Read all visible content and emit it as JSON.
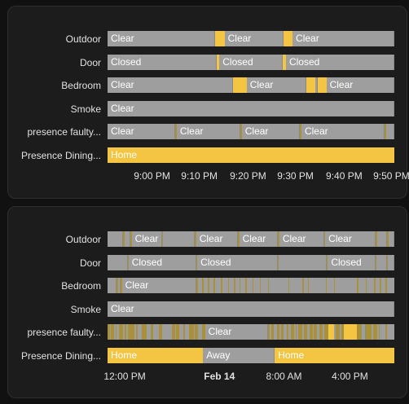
{
  "colors": {
    "gray": "#9e9e9e",
    "yellow": "#f4c542",
    "olive": "#a8913a",
    "background": "#111111",
    "card": "#1c1c1c"
  },
  "card1": {
    "rows": [
      {
        "label": "Outdoor",
        "segments": [
          {
            "start": 0,
            "end": 0.375,
            "state": "gray",
            "text": "Clear"
          },
          {
            "start": 0.375,
            "end": 0.408,
            "state": "yellow"
          },
          {
            "start": 0.408,
            "end": 0.615,
            "state": "gray",
            "text": "Clear"
          },
          {
            "start": 0.615,
            "end": 0.645,
            "state": "yellow"
          },
          {
            "start": 0.645,
            "end": 1,
            "state": "gray",
            "text": "Clear"
          }
        ]
      },
      {
        "label": "Door",
        "segments": [
          {
            "start": 0,
            "end": 0.38,
            "state": "gray",
            "text": "Closed"
          },
          {
            "start": 0.38,
            "end": 0.39,
            "state": "yellow"
          },
          {
            "start": 0.39,
            "end": 0.612,
            "state": "gray",
            "text": "Closed"
          },
          {
            "start": 0.612,
            "end": 0.622,
            "state": "yellow"
          },
          {
            "start": 0.622,
            "end": 1,
            "state": "gray",
            "text": "Closed"
          }
        ]
      },
      {
        "label": "Bedroom",
        "segments": [
          {
            "start": 0,
            "end": 0.437,
            "state": "gray",
            "text": "Clear"
          },
          {
            "start": 0.437,
            "end": 0.485,
            "state": "yellow"
          },
          {
            "start": 0.485,
            "end": 0.693,
            "state": "gray",
            "text": "Clear"
          },
          {
            "start": 0.693,
            "end": 0.725,
            "state": "yellow"
          },
          {
            "start": 0.725,
            "end": 0.733,
            "state": "gray"
          },
          {
            "start": 0.733,
            "end": 0.763,
            "state": "yellow"
          },
          {
            "start": 0.763,
            "end": 1,
            "state": "gray",
            "text": "Clear"
          }
        ]
      },
      {
        "label": "Smoke",
        "segments": [
          {
            "start": 0,
            "end": 1,
            "state": "gray",
            "text": "Clear"
          }
        ]
      },
      {
        "label": "presence faulty...",
        "segments": [
          {
            "start": 0,
            "end": 0.235,
            "state": "gray",
            "text": "Clear"
          },
          {
            "start": 0.235,
            "end": 0.241,
            "state": "olive"
          },
          {
            "start": 0.241,
            "end": 0.462,
            "state": "gray",
            "text": "Clear"
          },
          {
            "start": 0.462,
            "end": 0.468,
            "state": "olive"
          },
          {
            "start": 0.468,
            "end": 0.67,
            "state": "gray",
            "text": "Clear"
          },
          {
            "start": 0.67,
            "end": 0.676,
            "state": "olive"
          },
          {
            "start": 0.676,
            "end": 0.965,
            "state": "gray",
            "text": "Clear"
          },
          {
            "start": 0.965,
            "end": 0.971,
            "state": "olive"
          },
          {
            "start": 0.971,
            "end": 1,
            "state": "gray"
          }
        ]
      },
      {
        "label": "Presence Dining...",
        "segments": [
          {
            "start": 0,
            "end": 1,
            "state": "yellow",
            "text": "Home"
          }
        ]
      }
    ],
    "axis": [
      {
        "label": "9:00 PM",
        "pos": 0.155
      },
      {
        "label": "9:10 PM",
        "pos": 0.32
      },
      {
        "label": "9:20 PM",
        "pos": 0.49
      },
      {
        "label": "9:30 PM",
        "pos": 0.655
      },
      {
        "label": "9:40 PM",
        "pos": 0.825
      },
      {
        "label": "9:50 PM",
        "pos": 0.99
      }
    ]
  },
  "card2": {
    "rows": [
      {
        "label": "Outdoor",
        "segments": [
          {
            "start": 0,
            "end": 0.055,
            "state": "gray"
          },
          {
            "start": 0.055,
            "end": 0.059,
            "state": "olive"
          },
          {
            "start": 0.059,
            "end": 0.08,
            "state": "gray"
          },
          {
            "start": 0.08,
            "end": 0.084,
            "state": "olive"
          },
          {
            "start": 0.084,
            "end": 0.19,
            "state": "gray",
            "text": "Clear"
          },
          {
            "start": 0.19,
            "end": 0.194,
            "state": "olive"
          },
          {
            "start": 0.194,
            "end": 0.305,
            "state": "gray"
          },
          {
            "start": 0.305,
            "end": 0.309,
            "state": "olive"
          },
          {
            "start": 0.309,
            "end": 0.455,
            "state": "gray",
            "text": "Clear"
          },
          {
            "start": 0.455,
            "end": 0.459,
            "state": "olive"
          },
          {
            "start": 0.459,
            "end": 0.595,
            "state": "gray",
            "text": "Clear"
          },
          {
            "start": 0.595,
            "end": 0.599,
            "state": "olive"
          },
          {
            "start": 0.599,
            "end": 0.755,
            "state": "gray",
            "text": "Clear"
          },
          {
            "start": 0.755,
            "end": 0.759,
            "state": "olive"
          },
          {
            "start": 0.759,
            "end": 0.935,
            "state": "gray",
            "text": "Clear"
          },
          {
            "start": 0.935,
            "end": 0.939,
            "state": "olive"
          },
          {
            "start": 0.939,
            "end": 0.975,
            "state": "gray"
          },
          {
            "start": 0.975,
            "end": 0.979,
            "state": "olive"
          },
          {
            "start": 0.979,
            "end": 1,
            "state": "gray"
          }
        ]
      },
      {
        "label": "Door",
        "segments": [
          {
            "start": 0,
            "end": 0.07,
            "state": "gray"
          },
          {
            "start": 0.07,
            "end": 0.073,
            "state": "olive"
          },
          {
            "start": 0.073,
            "end": 0.31,
            "state": "gray",
            "text": "Closed"
          },
          {
            "start": 0.31,
            "end": 0.313,
            "state": "olive"
          },
          {
            "start": 0.313,
            "end": 0.595,
            "state": "gray",
            "text": "Closed"
          },
          {
            "start": 0.595,
            "end": 0.598,
            "state": "olive"
          },
          {
            "start": 0.598,
            "end": 0.765,
            "state": "gray"
          },
          {
            "start": 0.765,
            "end": 0.768,
            "state": "olive"
          },
          {
            "start": 0.768,
            "end": 0.935,
            "state": "gray",
            "text": "Closed"
          },
          {
            "start": 0.935,
            "end": 0.938,
            "state": "olive"
          },
          {
            "start": 0.938,
            "end": 0.975,
            "state": "gray"
          },
          {
            "start": 0.975,
            "end": 0.978,
            "state": "olive"
          },
          {
            "start": 0.978,
            "end": 1,
            "state": "gray"
          }
        ]
      },
      {
        "label": "Bedroom",
        "segments": [
          {
            "start": 0,
            "end": 0.032,
            "state": "gray"
          },
          {
            "start": 0.032,
            "end": 0.036,
            "state": "olive"
          },
          {
            "start": 0.036,
            "end": 0.045,
            "state": "gray"
          },
          {
            "start": 0.045,
            "end": 0.05,
            "state": "olive"
          },
          {
            "start": 0.05,
            "end": 0.31,
            "state": "gray",
            "text": "Clear"
          },
          {
            "start": 0.31,
            "end": 0.315,
            "state": "olive"
          },
          {
            "start": 0.33,
            "end": 0.335,
            "state": "olive"
          },
          {
            "start": 0.35,
            "end": 0.354,
            "state": "olive"
          },
          {
            "start": 0.37,
            "end": 0.375,
            "state": "olive"
          },
          {
            "start": 0.395,
            "end": 0.4,
            "state": "olive"
          },
          {
            "start": 0.42,
            "end": 0.424,
            "state": "olive"
          },
          {
            "start": 0.44,
            "end": 0.445,
            "state": "olive"
          },
          {
            "start": 0.46,
            "end": 0.463,
            "state": "olive"
          },
          {
            "start": 0.48,
            "end": 0.485,
            "state": "olive"
          },
          {
            "start": 0.505,
            "end": 0.508,
            "state": "olive"
          },
          {
            "start": 0.53,
            "end": 0.535,
            "state": "olive"
          },
          {
            "start": 0.56,
            "end": 0.563,
            "state": "olive"
          },
          {
            "start": 0.63,
            "end": 0.634,
            "state": "olive"
          },
          {
            "start": 0.68,
            "end": 0.684,
            "state": "olive"
          },
          {
            "start": 0.7,
            "end": 0.703,
            "state": "olive"
          },
          {
            "start": 0.76,
            "end": 0.764,
            "state": "olive"
          },
          {
            "start": 0.79,
            "end": 0.793,
            "state": "olive"
          },
          {
            "start": 0.87,
            "end": 0.874,
            "state": "olive"
          },
          {
            "start": 0.9,
            "end": 0.904,
            "state": "olive"
          },
          {
            "start": 0.93,
            "end": 0.934,
            "state": "olive"
          },
          {
            "start": 0.95,
            "end": 0.954,
            "state": "olive"
          },
          {
            "start": 0.97,
            "end": 0.974,
            "state": "olive"
          }
        ]
      },
      {
        "label": "Smoke",
        "segments": [
          {
            "start": 0,
            "end": 1,
            "state": "gray",
            "text": "Clear"
          }
        ]
      },
      {
        "label": "presence faulty...",
        "segments": [
          {
            "start": 0,
            "end": 0.008,
            "state": "olive"
          },
          {
            "start": 0.012,
            "end": 0.022,
            "state": "olive"
          },
          {
            "start": 0.028,
            "end": 0.032,
            "state": "olive"
          },
          {
            "start": 0.04,
            "end": 0.055,
            "state": "olive"
          },
          {
            "start": 0.06,
            "end": 0.065,
            "state": "olive"
          },
          {
            "start": 0.072,
            "end": 0.095,
            "state": "olive"
          },
          {
            "start": 0.1,
            "end": 0.105,
            "state": "olive"
          },
          {
            "start": 0.12,
            "end": 0.135,
            "state": "olive"
          },
          {
            "start": 0.15,
            "end": 0.16,
            "state": "olive"
          },
          {
            "start": 0.18,
            "end": 0.19,
            "state": "olive"
          },
          {
            "start": 0.225,
            "end": 0.235,
            "state": "olive"
          },
          {
            "start": 0.24,
            "end": 0.25,
            "state": "olive"
          },
          {
            "start": 0.265,
            "end": 0.27,
            "state": "olive"
          },
          {
            "start": 0.285,
            "end": 0.3,
            "state": "olive"
          },
          {
            "start": 0.305,
            "end": 0.315,
            "state": "olive"
          },
          {
            "start": 0.33,
            "end": 0.34,
            "state": "olive"
          },
          {
            "start": 0.34,
            "end": 0.56,
            "state": "gray",
            "text": "Clear"
          },
          {
            "start": 0.56,
            "end": 0.565,
            "state": "olive"
          },
          {
            "start": 0.57,
            "end": 0.58,
            "state": "olive"
          },
          {
            "start": 0.59,
            "end": 0.6,
            "state": "olive"
          },
          {
            "start": 0.605,
            "end": 0.615,
            "state": "olive"
          },
          {
            "start": 0.625,
            "end": 0.63,
            "state": "olive"
          },
          {
            "start": 0.64,
            "end": 0.65,
            "state": "olive"
          },
          {
            "start": 0.655,
            "end": 0.66,
            "state": "olive"
          },
          {
            "start": 0.665,
            "end": 0.68,
            "state": "olive"
          },
          {
            "start": 0.685,
            "end": 0.695,
            "state": "olive"
          },
          {
            "start": 0.705,
            "end": 0.715,
            "state": "olive"
          },
          {
            "start": 0.72,
            "end": 0.73,
            "state": "olive"
          },
          {
            "start": 0.74,
            "end": 0.75,
            "state": "olive"
          },
          {
            "start": 0.755,
            "end": 0.77,
            "state": "olive"
          },
          {
            "start": 0.77,
            "end": 0.79,
            "state": "yellow"
          },
          {
            "start": 0.795,
            "end": 0.81,
            "state": "olive"
          },
          {
            "start": 0.815,
            "end": 0.825,
            "state": "olive"
          },
          {
            "start": 0.825,
            "end": 0.87,
            "state": "yellow"
          },
          {
            "start": 0.87,
            "end": 0.885,
            "state": "olive"
          },
          {
            "start": 0.885,
            "end": 0.9,
            "state": "gray"
          },
          {
            "start": 0.9,
            "end": 0.92,
            "state": "olive"
          },
          {
            "start": 0.925,
            "end": 0.94,
            "state": "olive"
          },
          {
            "start": 0.945,
            "end": 0.95,
            "state": "olive"
          },
          {
            "start": 0.97,
            "end": 0.975,
            "state": "olive"
          }
        ]
      },
      {
        "label": "Presence Dining...",
        "segments": [
          {
            "start": 0,
            "end": 0.333,
            "state": "yellow",
            "text": "Home"
          },
          {
            "start": 0.333,
            "end": 0.583,
            "state": "gray",
            "text": "Away"
          },
          {
            "start": 0.583,
            "end": 1,
            "state": "yellow",
            "text": "Home"
          }
        ]
      }
    ],
    "axis": [
      {
        "label": "12:00 PM",
        "pos": 0.06,
        "bold": false
      },
      {
        "label": "Feb 14",
        "pos": 0.39,
        "bold": true
      },
      {
        "label": "8:00 AM",
        "pos": 0.615,
        "bold": false
      },
      {
        "label": "4:00 PM",
        "pos": 0.845,
        "bold": false
      }
    ]
  }
}
